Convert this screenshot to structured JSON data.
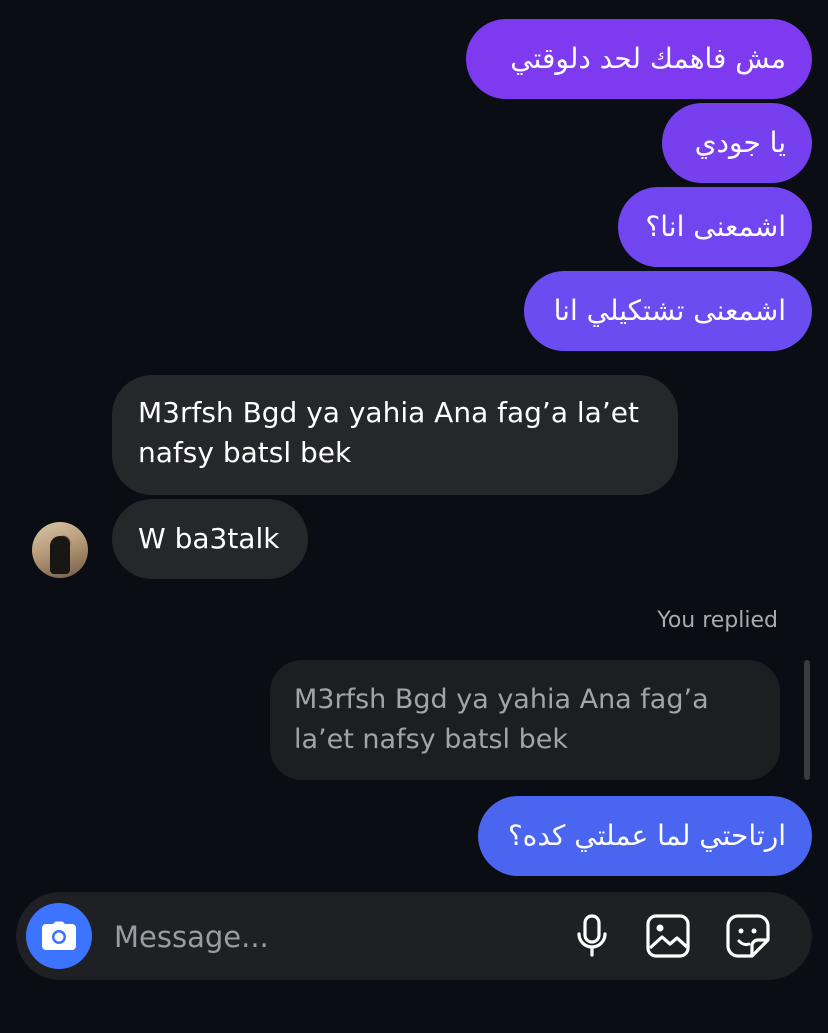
{
  "messages_out_top": [
    {
      "text": "مش فاهمك لحد دلوقتي"
    },
    {
      "text": "يا جودي"
    },
    {
      "text": "اشمعنى انا؟"
    },
    {
      "text": "اشمعنى تشتكيلي انا"
    }
  ],
  "messages_in": [
    {
      "text": "M3rfsh Bgd ya yahia Ana fag’a la’et nafsy batsl bek"
    },
    {
      "text": "W ba3talk"
    }
  ],
  "reply": {
    "label": "You replied",
    "quoted_text": "M3rfsh Bgd ya yahia Ana fag’a la’et nafsy batsl bek",
    "text": "ارتاحتي لما عملتي كده؟"
  },
  "composer": {
    "placeholder": "Message...",
    "icons": [
      "camera-icon",
      "microphone-icon",
      "gallery-icon",
      "sticker-icon"
    ]
  },
  "colors": {
    "background": "#0b0d14",
    "outgoing_purple": "#7a3df0",
    "outgoing_blue": "#4a65f0",
    "incoming": "#26272b",
    "camera_button": "#3c73ff"
  }
}
